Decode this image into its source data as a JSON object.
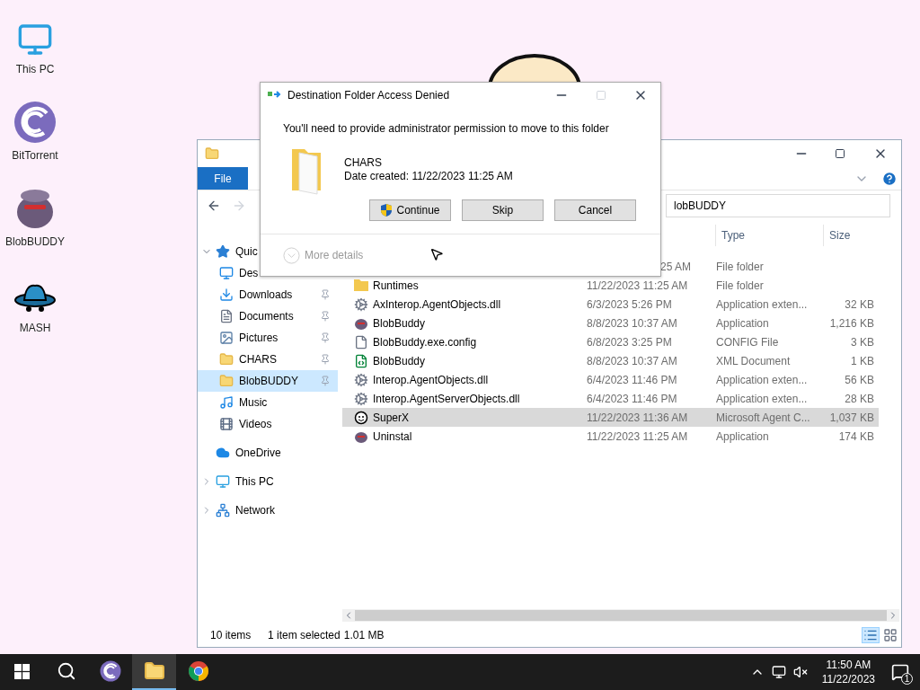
{
  "desktop_icons": [
    {
      "label": "This PC",
      "kind": "pc"
    },
    {
      "label": "BitTorrent",
      "kind": "torrent"
    },
    {
      "label": "BlobBUDDY",
      "kind": "blob"
    },
    {
      "label": "MASH",
      "kind": "hat"
    }
  ],
  "explorer": {
    "file_tab": "File",
    "address": "lobBUDDY",
    "columns": [
      "Type",
      "Size"
    ],
    "sidebar": [
      {
        "label": "Quic",
        "kind": "star",
        "expanded": true,
        "children": [
          {
            "label": "Des",
            "kind": "desktop",
            "pinned": false,
            "selected": false
          },
          {
            "label": "Downloads",
            "kind": "download",
            "pinned": true,
            "selected": false
          },
          {
            "label": "Documents",
            "kind": "document",
            "pinned": true,
            "selected": false
          },
          {
            "label": "Pictures",
            "kind": "picture",
            "pinned": true,
            "selected": false
          },
          {
            "label": "CHARS",
            "kind": "folder",
            "pinned": true,
            "selected": false
          },
          {
            "label": "BlobBUDDY",
            "kind": "folder",
            "pinned": true,
            "selected": true
          },
          {
            "label": "Music",
            "kind": "music",
            "pinned": false,
            "selected": false
          },
          {
            "label": "Videos",
            "kind": "video",
            "pinned": false,
            "selected": false
          }
        ]
      },
      {
        "label": "OneDrive",
        "kind": "cloud"
      },
      {
        "label": "This PC",
        "kind": "pc",
        "expanded": false
      },
      {
        "label": "Network",
        "kind": "network",
        "expanded": false
      }
    ],
    "rows": [
      {
        "date": "25 AM",
        "type": "File folder",
        "selected": false
      },
      {
        "name": "Runtimes",
        "kind": "folder",
        "date": "11/22/2023 11:25 AM",
        "type": "File folder",
        "selected": false
      },
      {
        "name": "AxInterop.AgentObjects.dll",
        "kind": "dll",
        "date": "6/3/2023 5:26 PM",
        "type": "Application exten...",
        "size": "32 KB",
        "selected": false
      },
      {
        "name": "BlobBuddy",
        "kind": "blob",
        "date": "8/8/2023 10:37 AM",
        "type": "Application",
        "size": "1,216 KB",
        "selected": false
      },
      {
        "name": "BlobBuddy.exe.config",
        "kind": "file",
        "date": "6/8/2023 3:25 PM",
        "type": "CONFIG File",
        "size": "3 KB",
        "selected": false
      },
      {
        "name": "BlobBuddy",
        "kind": "xml",
        "date": "8/8/2023 10:37 AM",
        "type": "XML Document",
        "size": "1 KB",
        "selected": false
      },
      {
        "name": "Interop.AgentObjects.dll",
        "kind": "dll",
        "date": "6/4/2023 11:46 PM",
        "type": "Application exten...",
        "size": "56 KB",
        "selected": false
      },
      {
        "name": "Interop.AgentServerObjects.dll",
        "kind": "dll",
        "date": "6/4/2023 11:46 PM",
        "type": "Application exten...",
        "size": "28 KB",
        "selected": false
      },
      {
        "name": "SuperX",
        "kind": "agent",
        "date": "11/22/2023 11:36 AM",
        "type": "Microsoft Agent C...",
        "size": "1,037 KB",
        "selected": true
      },
      {
        "name": "Uninstal",
        "kind": "blob",
        "date": "11/22/2023 11:25 AM",
        "type": "Application",
        "size": "174 KB",
        "selected": false
      }
    ],
    "status": {
      "count": "10 items",
      "selection": "1 item selected",
      "size": "1.01 MB"
    }
  },
  "dialog": {
    "title": "Destination Folder Access Denied",
    "maximize_disabled": true,
    "message": "You'll need to provide administrator permission to move to this folder",
    "item": {
      "name": "CHARS",
      "date": "Date created: 11/22/2023 11:25 AM"
    },
    "buttons": [
      {
        "label": "Continue",
        "kind": "shield"
      },
      {
        "label": "Skip",
        "kind": "plain"
      },
      {
        "label": "Cancel",
        "kind": "plain"
      }
    ],
    "more_details": "More details",
    "more_details_disabled": true
  },
  "taskbar": {
    "apps": [
      {
        "kind": "start"
      },
      {
        "kind": "search"
      },
      {
        "kind": "torrent",
        "active": false
      },
      {
        "kind": "explorer",
        "active": true
      },
      {
        "kind": "chrome",
        "active": false
      }
    ],
    "time": "11:50 AM",
    "date": "11/22/2023",
    "notifications": "1"
  }
}
